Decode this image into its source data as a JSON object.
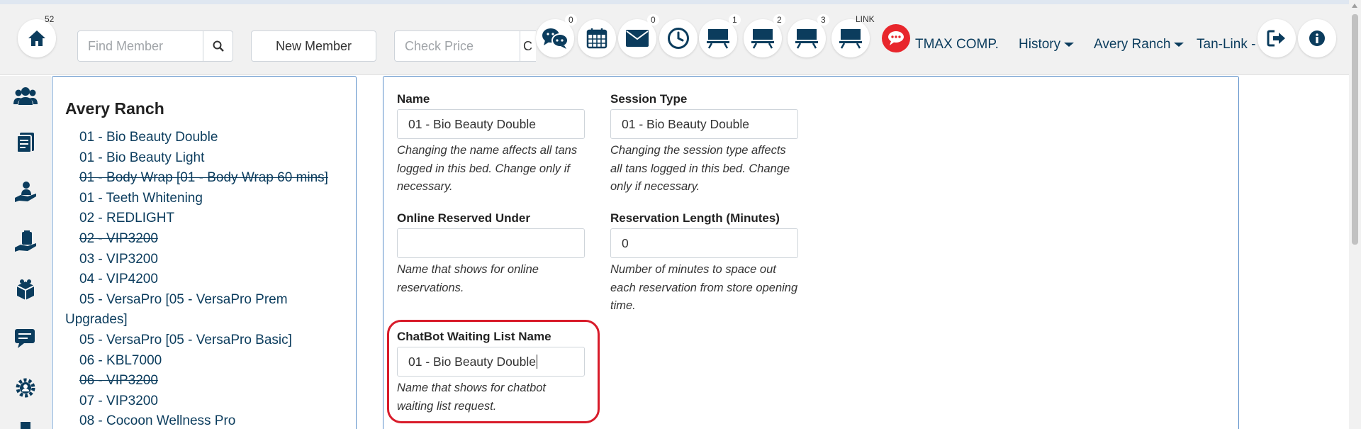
{
  "topbar": {
    "home_badge": "52",
    "find_member_placeholder": "Find Member",
    "new_member_label": "New Member",
    "check_price_placeholder": "Check Price",
    "check_price_addon": "C",
    "icons": [
      {
        "name": "chat-bubbles-icon",
        "badge": "0"
      },
      {
        "name": "calendar-icon",
        "badge": ""
      },
      {
        "name": "mail-icon",
        "badge": "0"
      },
      {
        "name": "clock-icon",
        "badge": ""
      },
      {
        "name": "tanning-bed-1-icon",
        "badge": "1"
      },
      {
        "name": "tanning-bed-2-icon",
        "badge": "2"
      },
      {
        "name": "tanning-bed-3-icon",
        "badge": "3"
      },
      {
        "name": "tanning-bed-link-icon",
        "badge": "LINK"
      }
    ],
    "company": "TMAX COMP.",
    "history_label": "History",
    "location_label": "Avery Ranch",
    "tanlink_label": "Tan-Link -"
  },
  "sidebar": {
    "icons": [
      "members-icon",
      "reports-icon",
      "services-icon",
      "products-icon",
      "packages-icon",
      "messages-icon",
      "settings-icon"
    ]
  },
  "left_panel": {
    "title": "Avery Ranch",
    "beds": [
      {
        "label": "01 - Bio Beauty Double",
        "struck": false
      },
      {
        "label": "01 - Bio Beauty Light",
        "struck": false
      },
      {
        "label": "01 - Body Wrap [01 - Body Wrap 60 mins]",
        "struck": true
      },
      {
        "label": "01 - Teeth Whitening",
        "struck": false
      },
      {
        "label": "02 - REDLIGHT",
        "struck": false
      },
      {
        "label": "02 - VIP3200",
        "struck": true
      },
      {
        "label": "03 - VIP3200",
        "struck": false
      },
      {
        "label": "04 - VIP4200",
        "struck": false
      },
      {
        "label": "05 - VersaPro [05 - VersaPro Prem Upgrades]",
        "struck": false
      },
      {
        "label": "05 - VersaPro [05 - VersaPro Basic]",
        "struck": false
      },
      {
        "label": "06 - KBL7000",
        "struck": false
      },
      {
        "label": "06 - VIP3200",
        "struck": true
      },
      {
        "label": "07 - VIP3200",
        "struck": false
      },
      {
        "label": "08 - Cocoon Wellness Pro",
        "struck": false
      }
    ]
  },
  "form": {
    "name": {
      "label": "Name",
      "value": "01 - Bio Beauty Double",
      "help": "Changing the name affects all tans logged in this bed. Change only if necessary."
    },
    "session_type": {
      "label": "Session Type",
      "value": "01 - Bio Beauty Double",
      "help": "Changing the session type affects all tans logged in this bed. Change only if necessary."
    },
    "online_reserved": {
      "label": "Online Reserved Under",
      "value": "",
      "help": "Name that shows for online reservations."
    },
    "reservation_length": {
      "label": "Reservation Length (Minutes)",
      "value": "0",
      "help": "Number of minutes to space out each reservation from store opening time."
    },
    "chatbot_name": {
      "label": "ChatBot Waiting List Name",
      "value": "01 - Bio Beauty Double",
      "help": "Name that shows for chatbot waiting list request."
    }
  },
  "colors": {
    "navy": "#0b3c5d",
    "panel_border": "#5b8fc9",
    "highlight": "#d81b2a",
    "chat_red": "#e8262c"
  }
}
